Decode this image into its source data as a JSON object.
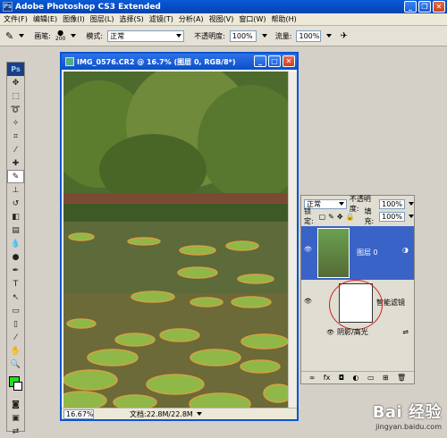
{
  "app": {
    "title": "Adobe Photoshop CS3 Extended"
  },
  "menu": [
    "文件(F)",
    "编辑(E)",
    "图像(I)",
    "图层(L)",
    "选择(S)",
    "滤镜(T)",
    "分析(A)",
    "视图(V)",
    "窗口(W)",
    "帮助(H)"
  ],
  "options": {
    "brush_label": "画笔:",
    "brush_size": "200",
    "mode_label": "模式:",
    "mode_value": "正常",
    "opacity_label": "不透明度:",
    "opacity_value": "100%",
    "flow_label": "流量:",
    "flow_value": "100%"
  },
  "toolbox": {
    "logo": "Ps",
    "fg_color": "#20e020",
    "bg_color": "#ffffff"
  },
  "document": {
    "title": "IMG_0576.CR2 @ 16.7% (图层 0, RGB/8*)",
    "zoom": "16.67%",
    "doc_size": "文档:22.8M/22.8M"
  },
  "layers": {
    "blend_mode": "正常",
    "opacity_label": "不透明度:",
    "opacity_value": "100%",
    "lock_label": "锁定:",
    "fill_label": "填充:",
    "fill_value": "100%",
    "layer_name": "图层 0",
    "smart_filter_label": "智能滤镜",
    "filter_name": "阴影/高光"
  },
  "watermark": {
    "logo": "Bai 经验",
    "url": "jingyan.baidu.com"
  }
}
